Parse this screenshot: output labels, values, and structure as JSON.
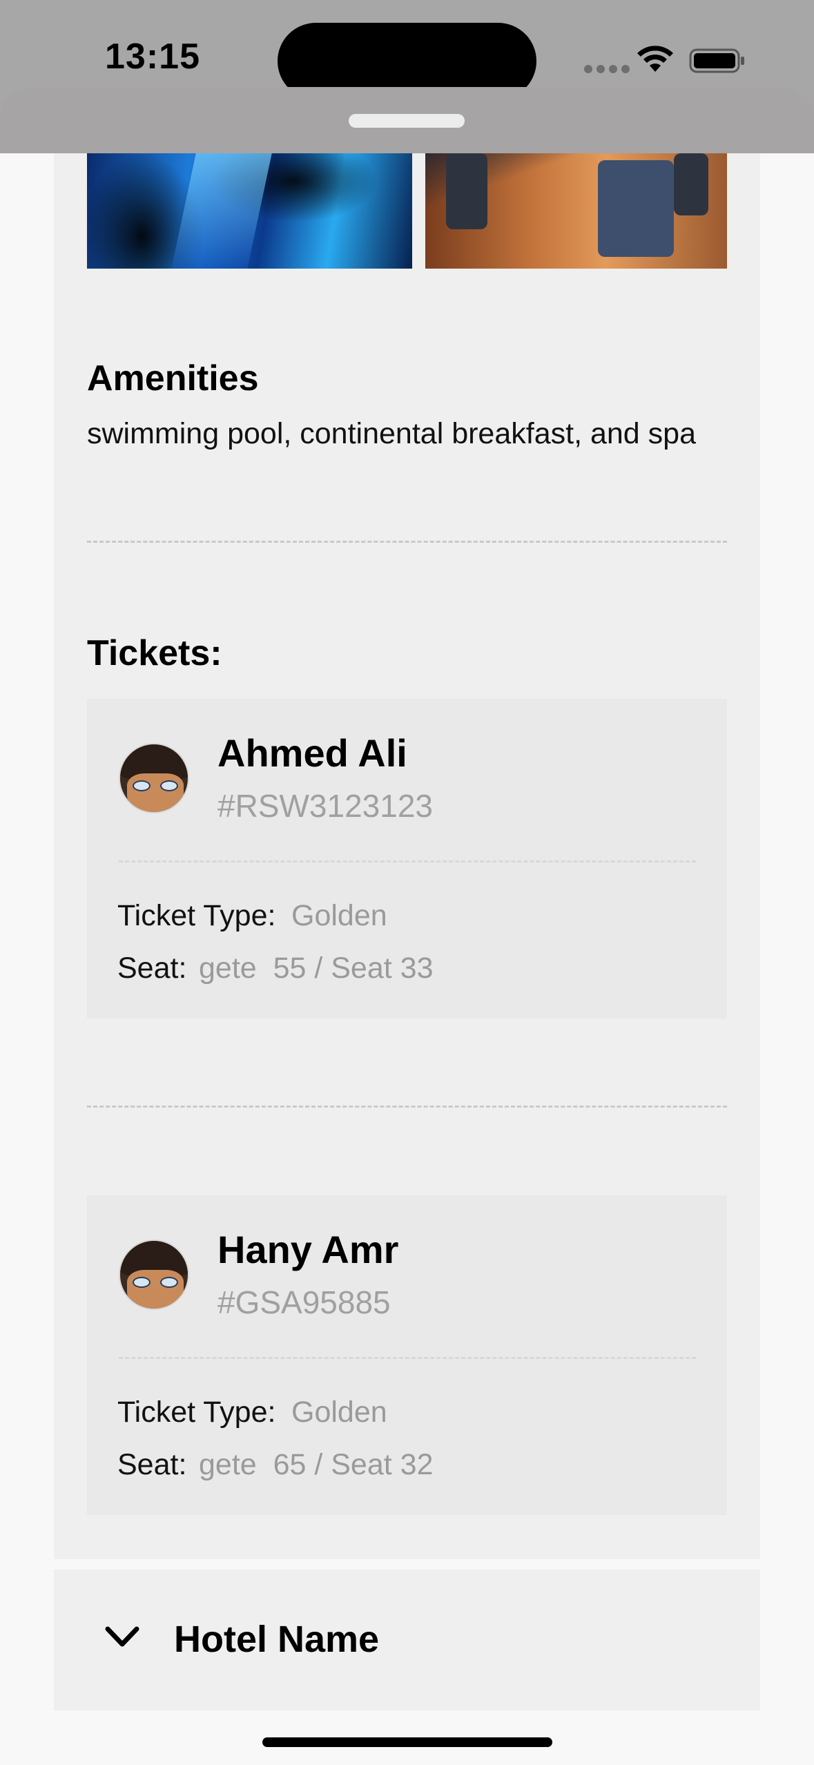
{
  "status_bar": {
    "time": "13:15"
  },
  "amenities": {
    "title": "Amenities",
    "text": "swimming pool, continental breakfast, and spa"
  },
  "tickets": {
    "title": "Tickets:",
    "items": [
      {
        "name": "Ahmed Ali",
        "code": "#RSW3123123",
        "type_label": "Ticket Type:",
        "type_value": "Golden",
        "seat_label": "Seat:",
        "seat_value": "gete  55 / Seat 33"
      },
      {
        "name": "Hany Amr",
        "code": "#GSA95885",
        "type_label": "Ticket Type:",
        "type_value": "Golden",
        "seat_label": "Seat:",
        "seat_value": "gete  65 / Seat 32"
      }
    ]
  },
  "hotel_section": {
    "title": "Hotel Name"
  }
}
